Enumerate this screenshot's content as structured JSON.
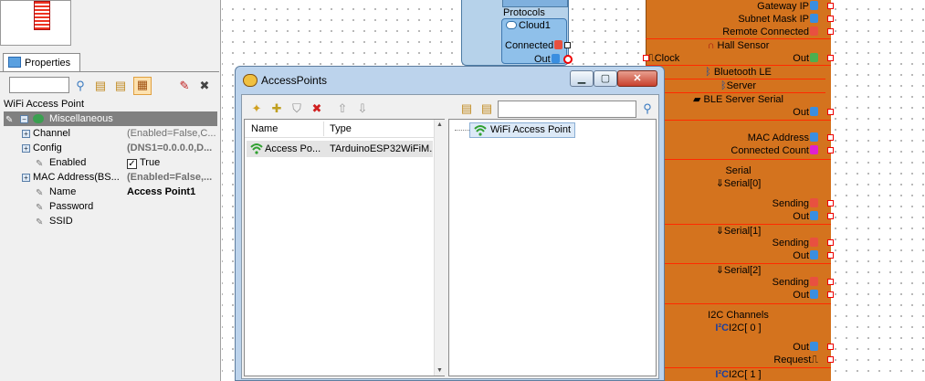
{
  "properties_panel": {
    "tab_label": "Properties",
    "object_title": "WiFi Access Point",
    "rows": [
      {
        "name": "Miscellaneous",
        "value": ""
      },
      {
        "name": "Channel",
        "value": "(Enabled=False,C..."
      },
      {
        "name": "Config",
        "value": "(DNS1=0.0.0.0,D..."
      },
      {
        "name": "Enabled",
        "value": "True"
      },
      {
        "name": "MAC Address(BS...",
        "value": "(Enabled=False,..."
      },
      {
        "name": "Name",
        "value": "Access Point1"
      },
      {
        "name": "Password",
        "value": ""
      },
      {
        "name": "SSID",
        "value": ""
      }
    ]
  },
  "cloud_component": {
    "protocols_label": "Protocols",
    "cloud_label": "Cloud1",
    "connected_label": "Connected",
    "out_label": "Out"
  },
  "board": {
    "gateway_ip": "Gateway IP",
    "subnet_mask_ip": "Subnet Mask IP",
    "remote_connected": "Remote Connected",
    "hall_sensor": "Hall Sensor",
    "clock": "Clock",
    "out": "Out",
    "bluetooth_le": "Bluetooth LE",
    "server": "Server",
    "ble_server_serial": "BLE Server Serial",
    "in": "n",
    "mac_address": "MAC Address",
    "connected_count": "Connected Count",
    "serial": "Serial",
    "serial0": "Serial[0]",
    "serial1": "Serial[1]",
    "serial2": "Serial[2]",
    "sending": "Sending",
    "i2c_channels": "I2C Channels",
    "i2c0": "I2C[ 0 ]",
    "i2c1": "I2C[ 1 ]",
    "request": "Request"
  },
  "dialog": {
    "title": "AccessPoints",
    "search_value": "",
    "list_headers": [
      "Name",
      "Type"
    ],
    "list_rows": [
      {
        "name": "Access Po...",
        "type": "TArduinoESP32WiFiM..."
      }
    ],
    "tree_items": [
      "WiFi Access Point"
    ]
  },
  "colors": {
    "board": "#d4731e",
    "dialog_frame": "#bcd3ec",
    "pin_border": "#ff0000"
  }
}
